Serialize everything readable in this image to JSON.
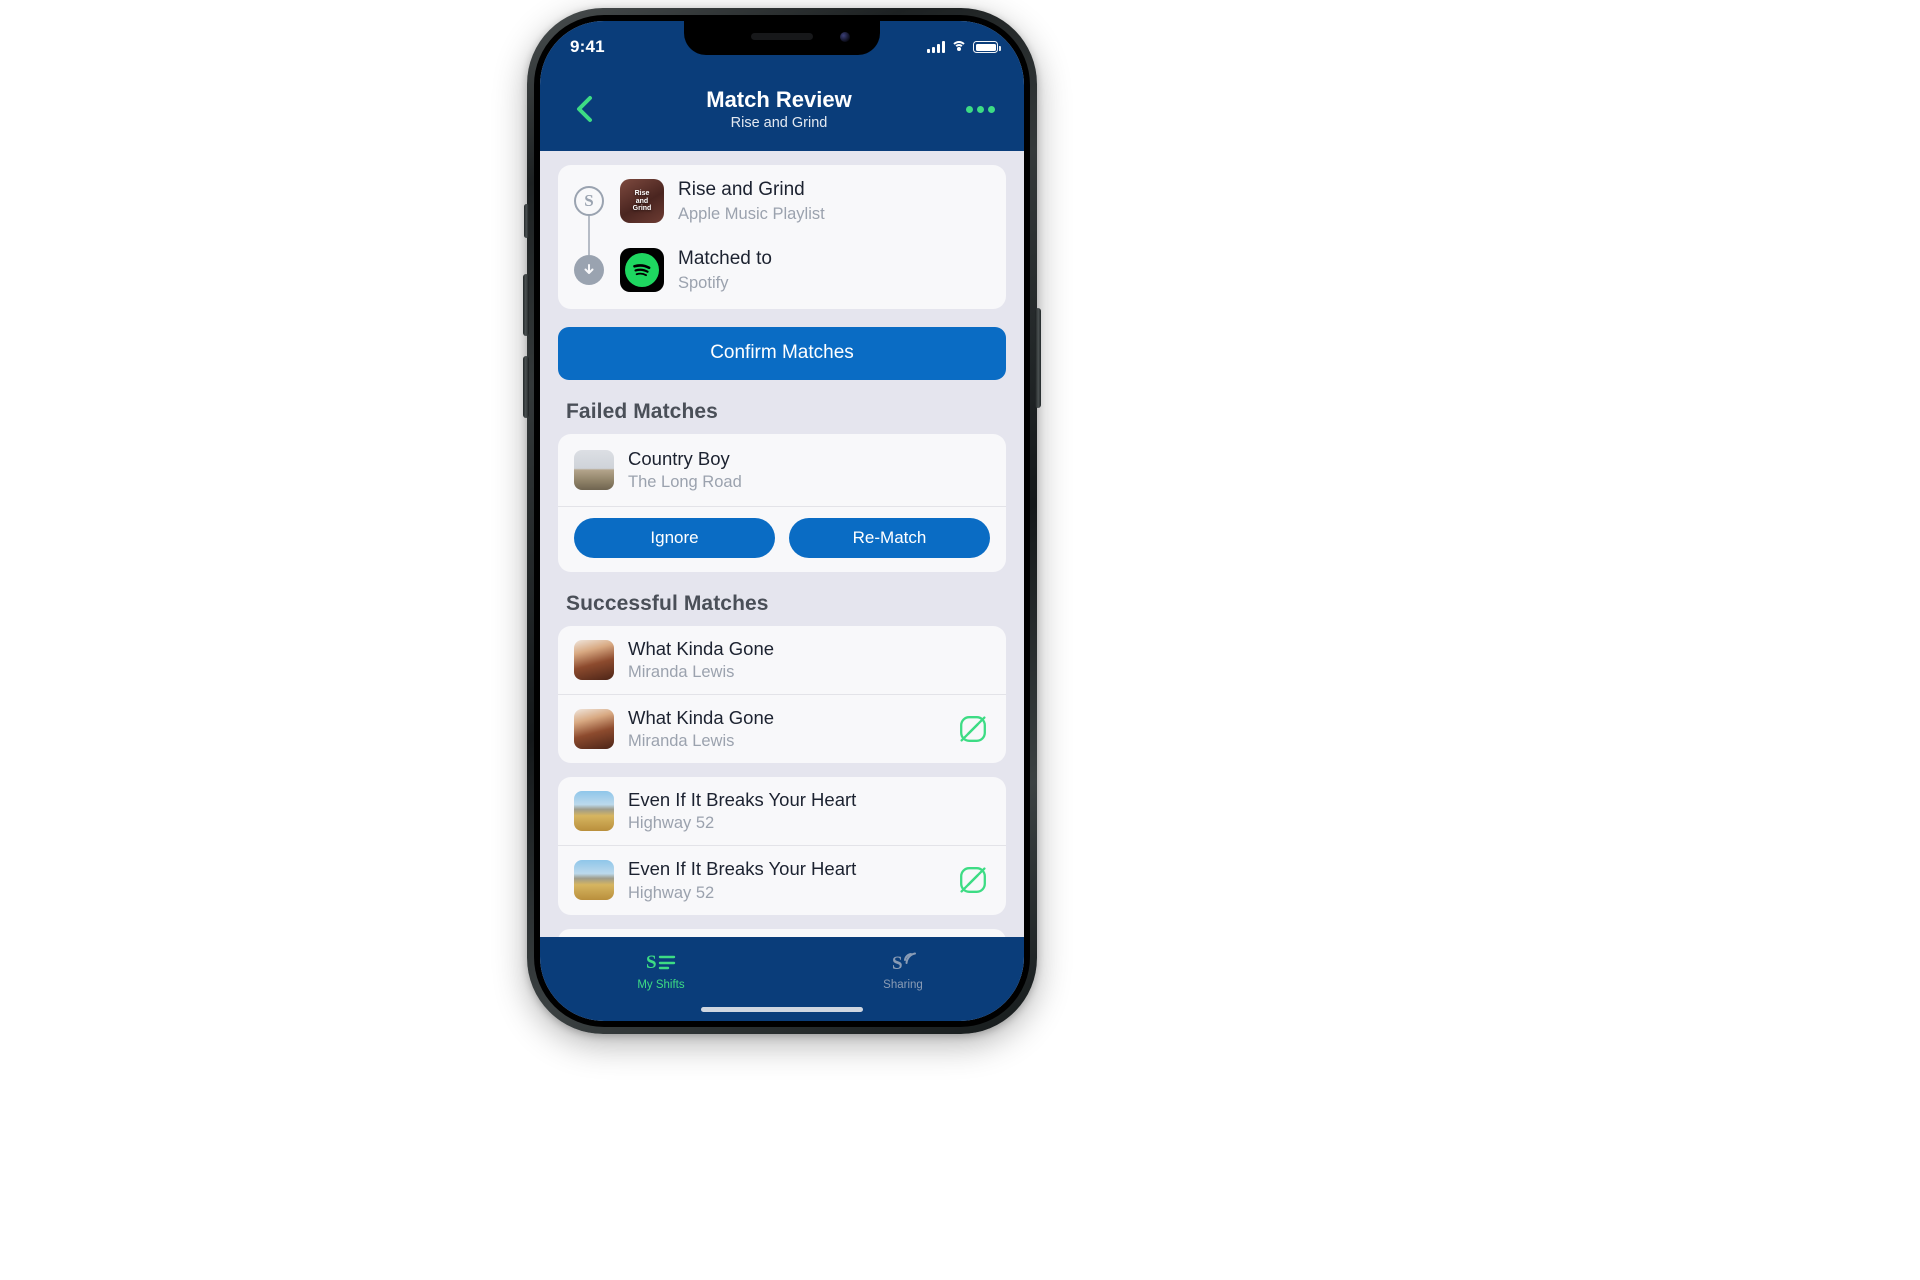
{
  "status_bar": {
    "time": "9:41",
    "signal": "signal-icon",
    "wifi": "wifi-icon",
    "battery": "battery-icon"
  },
  "nav": {
    "back_icon": "chevron-left-icon",
    "title": "Match Review",
    "subtitle": "Rise and Grind",
    "more_icon": "more-horizontal-icon",
    "accent": "#3ddc84",
    "bar_color": "#0a3d7a"
  },
  "source_card": {
    "source": {
      "badge_icon": "shift-s-icon",
      "artwork": "playlist-artwork",
      "artwork_text_line1": "Rise",
      "artwork_text_line2": "and",
      "artwork_text_line3": "Grind",
      "title": "Rise and Grind",
      "subtitle": "Apple Music Playlist"
    },
    "target": {
      "badge_icon": "arrow-down-icon",
      "artwork": "spotify-icon",
      "title": "Matched to",
      "subtitle": "Spotify"
    }
  },
  "confirm_button": {
    "label": "Confirm Matches",
    "color": "#0a6cc4"
  },
  "failed_section": {
    "title": "Failed Matches",
    "item": {
      "artwork": "long-road-artwork",
      "title": "Country Boy",
      "subtitle": "The Long Road"
    },
    "actions": [
      {
        "label": "Ignore",
        "name": "ignore-button"
      },
      {
        "label": "Re-Match",
        "name": "re-match-button"
      }
    ]
  },
  "successful_section": {
    "title": "Successful Matches",
    "groups": [
      {
        "rows": [
          {
            "artwork": "girl-artwork",
            "title": "What Kinda Gone",
            "subtitle": "Miranda Lewis",
            "link_icon": false
          },
          {
            "artwork": "girl-artwork",
            "title": "What Kinda Gone",
            "subtitle": "Miranda Lewis",
            "link_icon": true
          }
        ]
      },
      {
        "rows": [
          {
            "artwork": "field-artwork",
            "title": "Even If It Breaks Your Heart",
            "subtitle": "Highway 52",
            "link_icon": false
          },
          {
            "artwork": "field-artwork",
            "title": "Even If It Breaks Your Heart",
            "subtitle": "Highway 52",
            "link_icon": true
          }
        ]
      }
    ],
    "link_icon_color": "#3ddc84"
  },
  "tab_bar": {
    "tabs": [
      {
        "label": "My Shifts",
        "icon": "shift-list-icon",
        "active": true
      },
      {
        "label": "Sharing",
        "icon": "share-wave-icon",
        "active": false
      }
    ],
    "active_color": "#3ddc84",
    "inactive_color": "#8a9cb5"
  }
}
